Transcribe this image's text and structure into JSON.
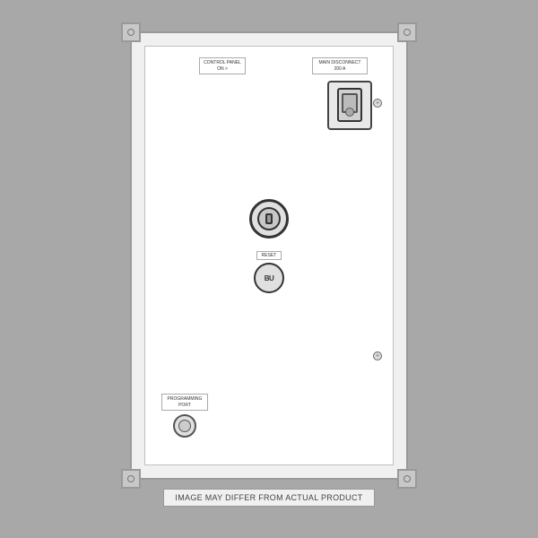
{
  "panel": {
    "control_panel_label_line1": "CONTROL PANEL",
    "control_panel_label_line2": "ON >",
    "main_disconnect_label_line1": "MAIN DISCONNECT",
    "main_disconnect_label_line2": "200 A",
    "reset_label": "RESET",
    "reset_button_text": "BU",
    "programming_port_label_line1": "PROGRAMMING",
    "programming_port_label_line2": "PORT"
  },
  "disclaimer": {
    "text": "IMAGE MAY DIFFER FROM ACTUAL PRODUCT"
  }
}
